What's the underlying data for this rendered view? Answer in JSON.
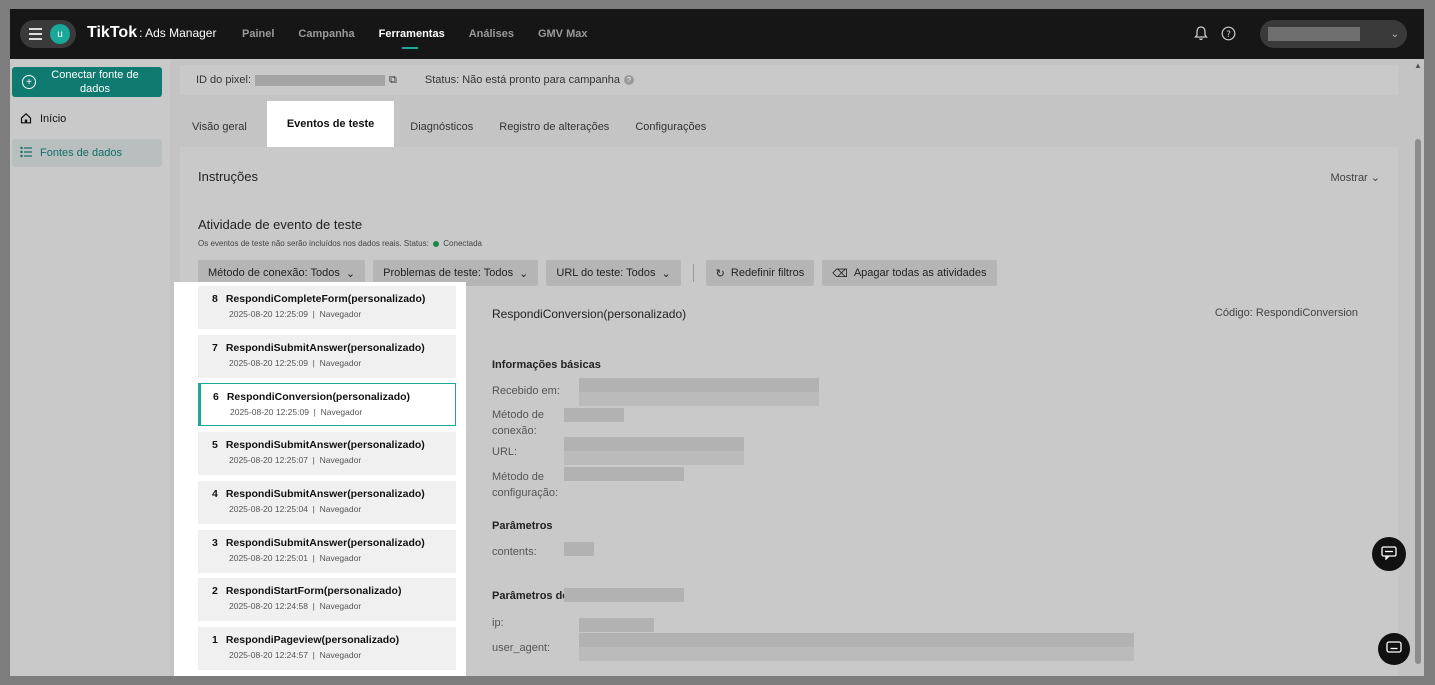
{
  "topbar": {
    "avatar_letter": "u",
    "brand": "TikTok",
    "brand_sub": ": Ads Manager",
    "nav": [
      "Painel",
      "Campanha",
      "Ferramentas",
      "Análises",
      "GMV Max"
    ],
    "active_nav": "Ferramentas",
    "icons": [
      "bell-icon",
      "help-icon",
      "chevron-down-icon"
    ]
  },
  "sidebar": {
    "connect_label": "Conectar fonte de dados",
    "items": [
      {
        "label": "Início",
        "icon": "home-icon"
      },
      {
        "label": "Fontes de dados",
        "icon": "list-icon"
      }
    ]
  },
  "pixel": {
    "id_label": "ID do pixel:",
    "status": "Status: Não está pronto para campanha"
  },
  "tabs": [
    "Visão geral",
    "Eventos de teste",
    "Diagnósticos",
    "Registro de alterações",
    "Configurações"
  ],
  "panel": {
    "instructions": "Instruções",
    "show": "Mostrar",
    "activity_title": "Atividade de evento de teste",
    "activity_sub": "Os eventos de teste não serão incluídos nos dados reais. Status:",
    "status_connected": "Conectada",
    "filters": {
      "method": "Método de conexão: Todos",
      "problems": "Problemas de teste: Todos",
      "url": "URL do teste: Todos",
      "reset": "Redefinir filtros",
      "clear": "Apagar todas as atividades"
    }
  },
  "events": [
    {
      "num": "8",
      "name": "RespondiCompleteForm(personalizado)",
      "time": "2025-08-20 12:25:09",
      "source": "Navegador"
    },
    {
      "num": "7",
      "name": "RespondiSubmitAnswer(personalizado)",
      "time": "2025-08-20 12:25:09",
      "source": "Navegador"
    },
    {
      "num": "6",
      "name": "RespondiConversion(personalizado)",
      "time": "2025-08-20 12:25:09",
      "source": "Navegador"
    },
    {
      "num": "5",
      "name": "RespondiSubmitAnswer(personalizado)",
      "time": "2025-08-20 12:25:07",
      "source": "Navegador"
    },
    {
      "num": "4",
      "name": "RespondiSubmitAnswer(personalizado)",
      "time": "2025-08-20 12:25:04",
      "source": "Navegador"
    },
    {
      "num": "3",
      "name": "RespondiSubmitAnswer(personalizado)",
      "time": "2025-08-20 12:25:01",
      "source": "Navegador"
    },
    {
      "num": "2",
      "name": "RespondiStartForm(personalizado)",
      "time": "2025-08-20 12:24:58",
      "source": "Navegador"
    },
    {
      "num": "1",
      "name": "RespondiPageview(personalizado)",
      "time": "2025-08-20 12:24:57",
      "source": "Navegador"
    }
  ],
  "selected_event": "6",
  "detail": {
    "title": "RespondiConversion(personalizado)",
    "code": "Código: RespondiConversion",
    "basic_info": "Informações básicas",
    "received": "Recebido em:",
    "connection_method": "Método de conexão:",
    "url": "URL:",
    "config_method": "Método de configuração:",
    "params": "Parâmetros",
    "contents": "contents:",
    "params_de": "Parâmetros de",
    "ip": "ip:",
    "user_agent": "user_agent:"
  }
}
